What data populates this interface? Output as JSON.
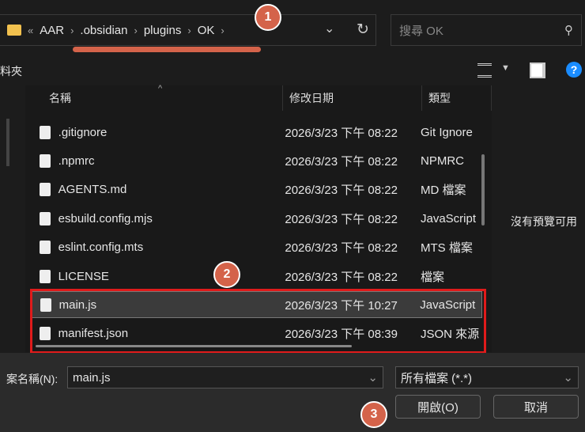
{
  "address": {
    "crumbs": [
      "AAR",
      ".obsidian",
      "plugins",
      "OK"
    ],
    "overflow": "«"
  },
  "search": {
    "placeholder": "搜尋 OK"
  },
  "toolbar": {
    "left_label": "料夾"
  },
  "columns": [
    "名稱",
    "修改日期",
    "類型"
  ],
  "files": [
    {
      "name": ".gitignore",
      "date": "2026/3/23 下午 08:22",
      "type": "Git Ignore"
    },
    {
      "name": ".npmrc",
      "date": "2026/3/23 下午 08:22",
      "type": "NPMRC"
    },
    {
      "name": "AGENTS.md",
      "date": "2026/3/23 下午 08:22",
      "type": "MD 檔案"
    },
    {
      "name": "esbuild.config.mjs",
      "date": "2026/3/23 下午 08:22",
      "type": "JavaScript"
    },
    {
      "name": "eslint.config.mts",
      "date": "2026/3/23 下午 08:22",
      "type": "MTS 檔案"
    },
    {
      "name": "LICENSE",
      "date": "2026/3/23 下午 08:22",
      "type": "檔案"
    },
    {
      "name": "main.js",
      "date": "2026/3/23 下午 10:27",
      "type": "JavaScript"
    },
    {
      "name": "manifest.json",
      "date": "2026/3/23 下午 08:39",
      "type": "JSON 來源"
    }
  ],
  "preview": "沒有預覽可用",
  "bottom": {
    "filename_label": "案名稱(N):",
    "filename_value": "main.js",
    "filter": "所有檔案 (*.*)",
    "open": "開啟(O)",
    "cancel": "取消"
  },
  "badges": [
    "1",
    "2",
    "3"
  ],
  "colors": {
    "accent": "#d4634a",
    "highlight": "#e01b1b"
  }
}
